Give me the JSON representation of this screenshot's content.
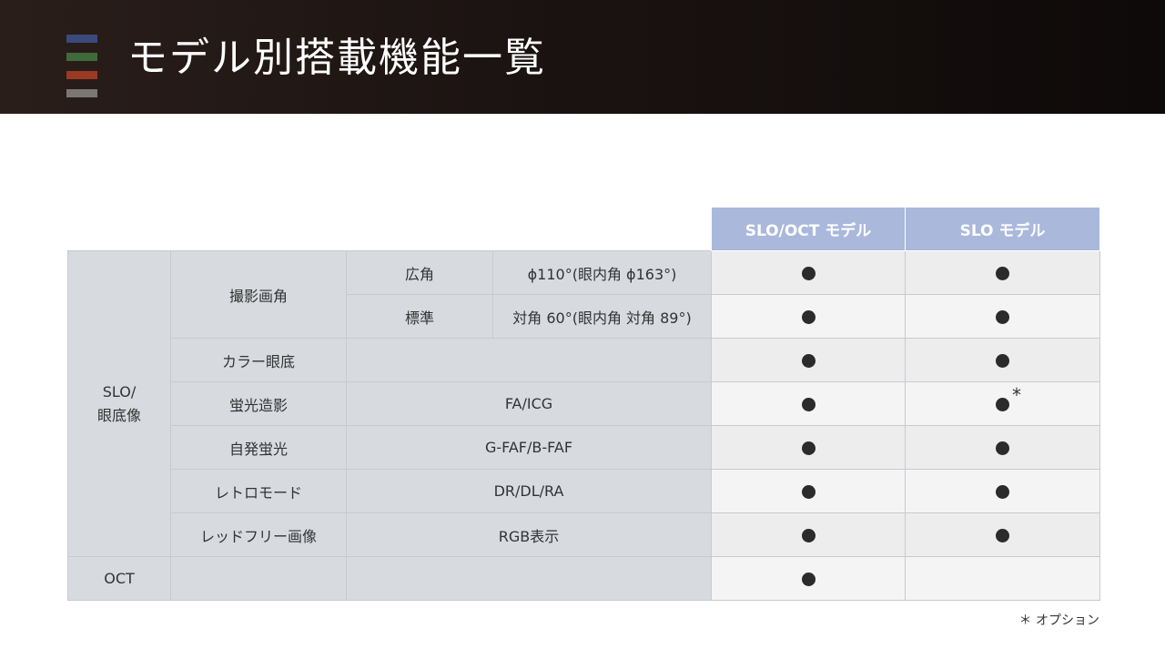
{
  "header": {
    "title": "モデル別搭載機能一覧",
    "bar_colors": [
      "#3a4a7a",
      "#3f6b3a",
      "#9a3a22",
      "#7a7674"
    ]
  },
  "table": {
    "columns": [
      "SLO/OCT モデル",
      "SLO モデル"
    ],
    "group_slo_label": "SLO/\n眼底像",
    "rows": [
      {
        "feature": "撮影画角",
        "sub": "広角",
        "detail": "ϕ110°(眼内角 ϕ163°)",
        "slo_oct": "●",
        "slo": "●"
      },
      {
        "sub": "標準",
        "detail": "対角 60°(眼内角 対角 89°)",
        "slo_oct": "●",
        "slo": "●"
      },
      {
        "feature": "カラー眼底",
        "detail": "",
        "slo_oct": "●",
        "slo": "●"
      },
      {
        "feature": "蛍光造影",
        "detail": "FA/ICG",
        "slo_oct": "●",
        "slo": "●",
        "slo_mark": "*"
      },
      {
        "feature": "自発蛍光",
        "detail": "G-FAF/B-FAF",
        "slo_oct": "●",
        "slo": "●"
      },
      {
        "feature": "レトロモード",
        "detail": "DR/DL/RA",
        "slo_oct": "●",
        "slo": "●"
      },
      {
        "feature": "レッドフリー画像",
        "detail": "RGB表示",
        "slo_oct": "●",
        "slo": "●"
      }
    ],
    "oct_row": {
      "label": "OCT",
      "slo_oct": "●",
      "slo": ""
    }
  },
  "footnote": "＊ オプション"
}
